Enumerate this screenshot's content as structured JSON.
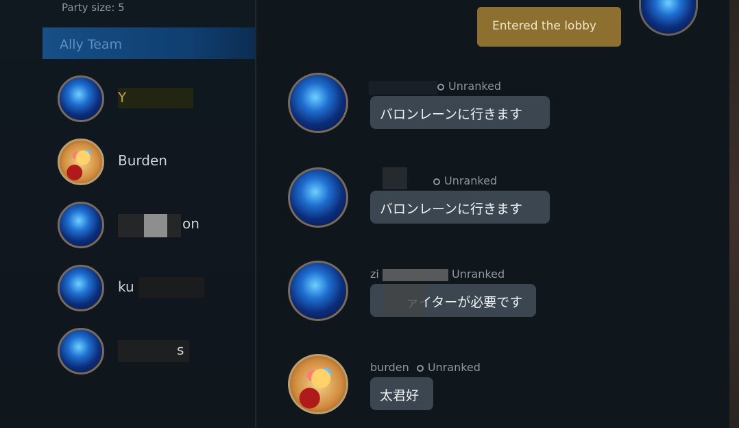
{
  "party": {
    "size_label": "Party size: 5"
  },
  "ally_team": {
    "label": "Ally Team",
    "members": [
      {
        "name": "Y",
        "avatar": "blue-hero"
      },
      {
        "name": "Burden",
        "avatar": "popcorn"
      },
      {
        "name": "on",
        "avatar": "blue-hero"
      },
      {
        "name": "ku",
        "avatar": "blue-hero"
      },
      {
        "name": "s",
        "avatar": "blue-hero"
      }
    ]
  },
  "chat": {
    "system_message": "Entered the lobby",
    "messages": [
      {
        "rank": "Unranked",
        "text": "バロンレーンに行きます",
        "avatar": "blue-hero"
      },
      {
        "rank": "Unranked",
        "text": "バロンレーンに行きます",
        "avatar": "blue-hero"
      },
      {
        "sender": "zi",
        "rank": "Unranked",
        "text": "ァイターが必要です",
        "avatar": "blue-hero"
      },
      {
        "sender": "burden",
        "rank": "Unranked",
        "text": "太君好",
        "avatar": "popcorn"
      }
    ]
  },
  "colors": {
    "ally_header": "#174f86",
    "system_bubble": "#8d7030",
    "chat_bubble": "#3b4650"
  }
}
